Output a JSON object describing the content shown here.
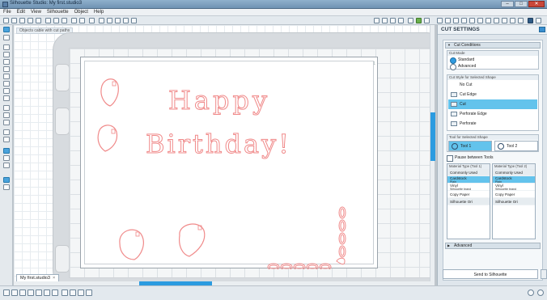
{
  "window": {
    "title": "Silhouette Studio: My first.studio3"
  },
  "menu": [
    "File",
    "Edit",
    "View",
    "Silhouette",
    "Object",
    "Help"
  ],
  "workspace": {
    "hint": "Objects cable with cut paths",
    "page_number": "1",
    "doc_tab": "My first.studio3",
    "doc_tab_close": "×",
    "greeting_line1": "Happy",
    "greeting_line2": "Birthday!",
    "art_color": "#f08a8a"
  },
  "panel": {
    "title": "CUT SETTINGS",
    "section_cut_conditions": "Cut Conditions",
    "cut_mode_label": "Cut Mode",
    "cut_modes": [
      "Standard",
      "Advanced"
    ],
    "cut_style_label": "Cut Style for Selected Shape",
    "cut_styles": [
      "No Cut",
      "Cut Edge",
      "Cut",
      "Perforate Edge",
      "Perforate"
    ],
    "tool_label": "Tool for Selected Shape",
    "tools": [
      "Tool 1",
      "Tool 2"
    ],
    "pause_label": "Pause between Tools",
    "material_tool1_label": "Material Type (Tool 1)",
    "material_tool2_label": "Material Type (Tool 2)",
    "materials": [
      {
        "name": "Commonly Used",
        "sub": ""
      },
      {
        "name": "Cardstock",
        "sub": "Plain"
      },
      {
        "name": "Vinyl",
        "sub": "Silhouette brand"
      },
      {
        "name": "Copy Paper",
        "sub": ""
      },
      {
        "name": "Silhouette Ori",
        "sub": ""
      }
    ],
    "section_advanced": "Advanced",
    "send_button": "Send to Silhouette"
  }
}
